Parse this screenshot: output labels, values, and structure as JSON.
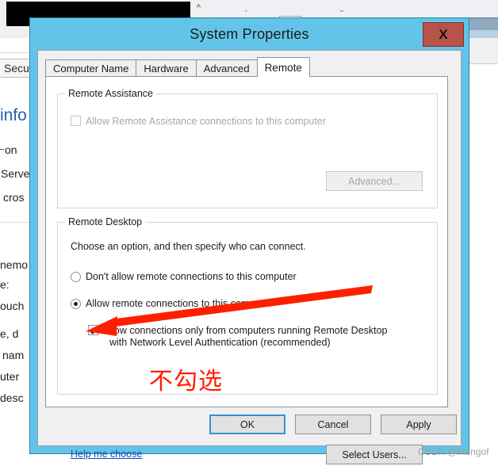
{
  "background": {
    "doc_fragments": {
      "secure_tab": "Secu",
      "heading": "info",
      "line1": "on",
      "line2": "Serve",
      "line3": "cros",
      "line4": "nemo",
      "line5": "e:",
      "line6": "ouch",
      "line7": "e, d",
      "line8": "nam",
      "line9": "uter",
      "line10": "desc"
    },
    "scroll_up_icon": "^"
  },
  "dialog": {
    "title": "System Properties",
    "close_label": "X",
    "tabs": [
      {
        "label": "Computer Name",
        "active": false
      },
      {
        "label": "Hardware",
        "active": false
      },
      {
        "label": "Advanced",
        "active": false
      },
      {
        "label": "Remote",
        "active": true
      }
    ],
    "remote_assistance": {
      "group_title": "Remote Assistance",
      "checkbox_label": "Allow Remote Assistance connections to this computer",
      "checkbox_checked": false,
      "checkbox_disabled": true,
      "advanced_button": "Advanced...",
      "advanced_disabled": true
    },
    "remote_desktop": {
      "group_title": "Remote Desktop",
      "description": "Choose an option, and then specify who can connect.",
      "options": [
        {
          "label": "Don't allow remote connections to this computer",
          "selected": false
        },
        {
          "label": "Allow remote connections to this computer",
          "selected": true
        }
      ],
      "nla_checkbox": {
        "line1": "Allow connections only from computers running Remote Desktop",
        "line2": "with Network Level Authentication (recommended)",
        "checked": true
      },
      "help_link": "Help me choose",
      "select_users_button": "Select Users..."
    },
    "footer": {
      "ok": "OK",
      "cancel": "Cancel",
      "apply": "Apply"
    }
  },
  "annotation": {
    "chinese_note": "不勾选",
    "arrow_color": "#ff1f00"
  },
  "watermark": "CSDN @Mengof",
  "colors": {
    "titlebar": "#62c4e8",
    "close_button": "#b9534a",
    "link": "#0b4cb4",
    "focus_border": "#3a8fd4",
    "annotation_red": "#ff1f00"
  }
}
